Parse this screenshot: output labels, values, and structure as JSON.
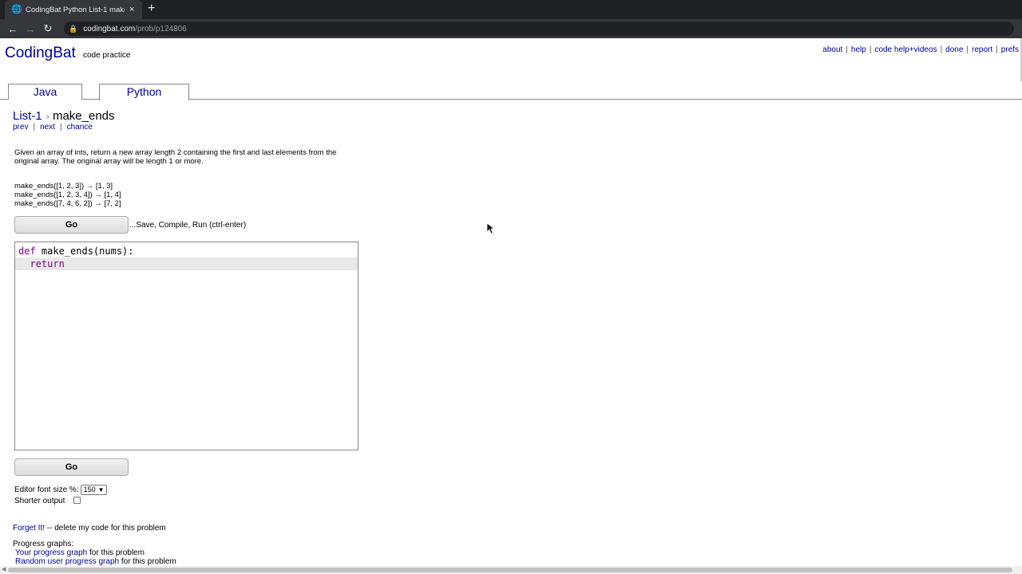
{
  "browser": {
    "tab_title": "CodingBat Python List-1 make_ends",
    "tab_close": "×",
    "new_tab": "+",
    "url_host": "codingbat.com",
    "url_path": "/prob/p124806"
  },
  "header": {
    "logo": "CodingBat",
    "logo_sub": "code practice",
    "links": [
      "about",
      "help",
      "code help+videos",
      "done",
      "report",
      "prefs"
    ]
  },
  "lang_tabs": [
    "Java",
    "Python"
  ],
  "breadcrumb": {
    "section": "List-1",
    "arrow": ">",
    "problem": "make_ends"
  },
  "subnav": [
    "prev",
    "next",
    "chance"
  ],
  "description": "Given an array of ints, return a new array length 2 containing the first and last elements from the original array. The original array will be length 1 or more.",
  "examples": [
    "make_ends([1, 2, 3]) → [1, 3]",
    "make_ends([1, 2, 3, 4]) → [1, 4]",
    "make_ends([7, 4, 6, 2]) → [7, 2]"
  ],
  "go_label": "Go",
  "go_hint": "...Save, Compile, Run (ctrl-enter)",
  "editor": {
    "line1_kw": "def",
    "line1_rest": " make_ends(nums):",
    "line2_kw": "return"
  },
  "options": {
    "font_size_label": "Editor font size %:",
    "font_size_value": "150",
    "shorter_label": "Shorter output"
  },
  "footer": {
    "forget_link": "Forget It!",
    "forget_text": " -- delete my code for this problem",
    "progress_title": "Progress graphs:",
    "your_graph_link": "Your progress graph",
    "your_graph_text": " for this problem",
    "random_graph_link": "Random user progress graph",
    "random_graph_text": " for this problem"
  },
  "colors": {
    "link": "#000099",
    "chrome_dark": "#202124",
    "chrome_mid": "#35363a",
    "keyword": "#770088"
  }
}
